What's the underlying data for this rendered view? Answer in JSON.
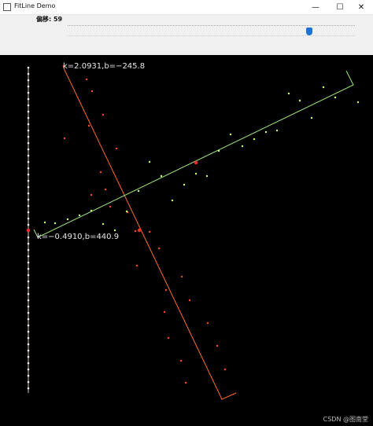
{
  "window": {
    "title": "FitLine Demo",
    "minimize_glyph": "—",
    "maximize_glyph": "☐",
    "close_glyph": "✕"
  },
  "toolbar": {
    "trackbar_label": "偏移: 59",
    "trackbar_value": 59,
    "trackbar_fraction": 0.84
  },
  "canvas": {
    "line1_label": "k=2.0931,b=−245.8",
    "line2_label": "k=−0.4910,b=440.9",
    "watermark": "CSDN @图南堂",
    "colors": {
      "background": "#000000",
      "line1": "#ff6a2a",
      "line2": "#9be87a",
      "axis_marks": "#d9c8a6",
      "point_red": "#ff4a22",
      "point_green": "#c8ff6e",
      "center": "#ff2a2a"
    }
  }
}
